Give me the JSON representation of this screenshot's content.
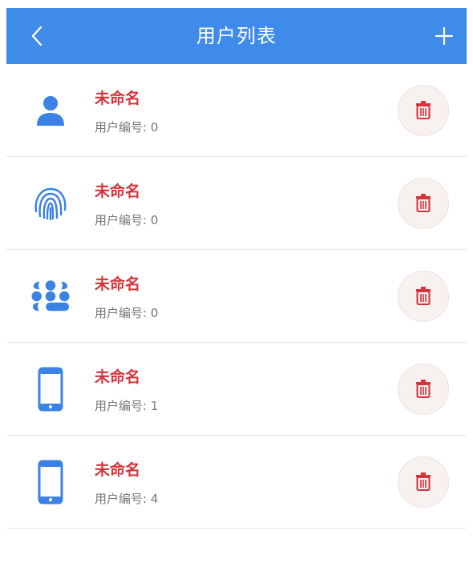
{
  "header": {
    "title": "用户列表"
  },
  "colors": {
    "accent": "#3f8bea",
    "name_red": "#d6333b",
    "icon_blue": "#3b82e4"
  },
  "users": [
    {
      "icon": "person-icon",
      "name": "未命名",
      "number_label": "用户编号: 0"
    },
    {
      "icon": "fingerprint-icon",
      "name": "未命名",
      "number_label": "用户编号: 0"
    },
    {
      "icon": "keypad-icon",
      "name": "未命名",
      "number_label": "用户编号: 0"
    },
    {
      "icon": "phone-icon",
      "name": "未命名",
      "number_label": "用户编号: 1"
    },
    {
      "icon": "phone-icon",
      "name": "未命名",
      "number_label": "用户编号: 4"
    }
  ]
}
